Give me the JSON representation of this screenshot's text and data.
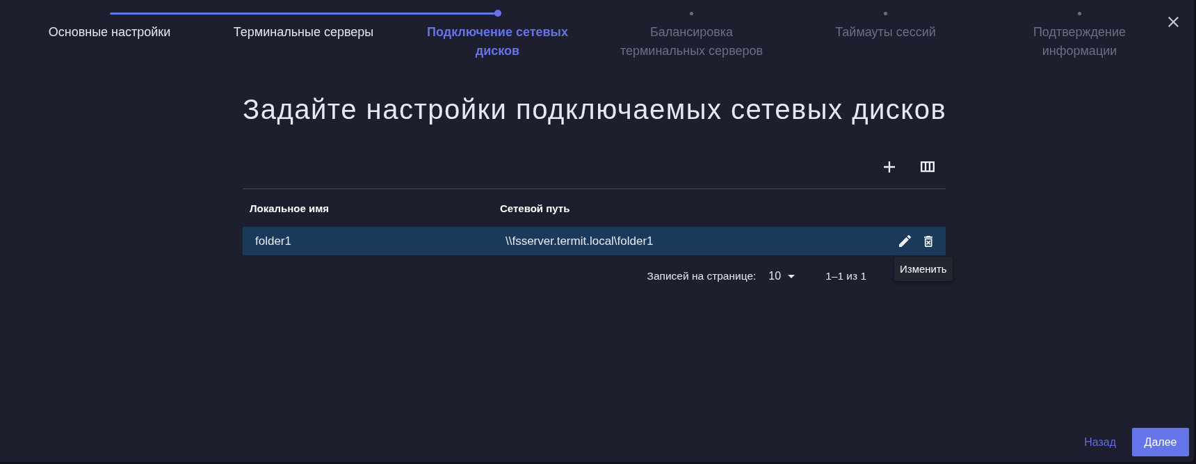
{
  "stepper": {
    "steps": [
      {
        "label": "Основные настройки",
        "completed": true,
        "selected": false
      },
      {
        "label": "Терминальные серверы",
        "completed": true,
        "selected": false
      },
      {
        "label": "Подключение сетевых дисков",
        "completed": false,
        "selected": true
      },
      {
        "label": "Балансировка терминальных серверов",
        "completed": false,
        "selected": false
      },
      {
        "label": "Таймауты сессий",
        "completed": false,
        "selected": false
      },
      {
        "label": "Подтверждение информации",
        "completed": false,
        "selected": false
      }
    ]
  },
  "heading": "Задайте настройки подключаемых сетевых дисков",
  "table": {
    "columns": [
      "Локальное имя",
      "Сетевой путь"
    ],
    "rows": [
      {
        "cells": [
          "folder1",
          "\\\\fsserver.termit.local\\folder1"
        ],
        "hovered": true
      }
    ],
    "tooltip": "Изменить",
    "pagination": {
      "rows_per_page_label": "Записей на странице:",
      "rows_per_page": "10",
      "range": "1–1 из 1"
    }
  },
  "footer": {
    "back": "Назад",
    "next": "Далее"
  }
}
